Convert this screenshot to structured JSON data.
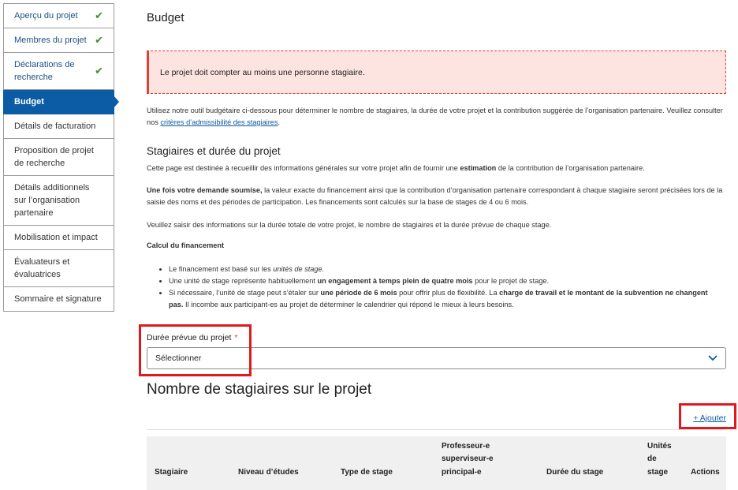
{
  "sidebar": {
    "items": [
      {
        "label": "Aperçu du projet",
        "done": true
      },
      {
        "label": "Membres du projet",
        "done": true
      },
      {
        "label": "Déclarations de recherche",
        "done": true
      },
      {
        "label": "Budget",
        "active": true
      },
      {
        "label": "Détails de facturation"
      },
      {
        "label": "Proposition de projet de recherche"
      },
      {
        "label": "Détails additionnels sur l’organisation partenaire"
      },
      {
        "label": "Mobilisation et impact"
      },
      {
        "label": "Évaluateurs et évaluatrices"
      },
      {
        "label": "Sommaire et signature"
      }
    ]
  },
  "main": {
    "title": "Budget",
    "error": "Le projet doit compter au moins une personne stagiaire.",
    "intro_text": "Utilisez notre outil budgétaire ci-dessous pour déterminer le nombre de stagiaires, la durée de votre projet et la contribution suggérée de l’organisation partenaire. Veuillez consulter nos",
    "intro_link": "critères d’admissibilité des stagiaires",
    "section_title": "Stagiaires et durée du projet",
    "para1_a": "Cette page est destinée à recueillir des informations générales sur votre projet afin de fournir une",
    "para1_b": "estimation",
    "para1_c": "de la contribution de l’organisation partenaire.",
    "para2_a": "Une fois votre demande soumise,",
    "para2_b": "la valeur exacte du financement ainsi que la contribution d’organisation partenaire correspondant à chaque stagiaire seront précisées lors de la saisie des noms et des périodes de participation. Les financements sont calculés sur la base de stages de 4 ou 6 mois.",
    "para3": "Veuillez saisir des informations sur la durée totale de votre projet, le nombre de stagiaires et la durée prévue de chaque stage.",
    "calc_title": "Calcul du financement",
    "b1_a": "Le financement est basé sur les",
    "b1_b": "unités de stage.",
    "b2_a": "Une unité de stage représente habituellement",
    "b2_b": "un engagement à temps plein de quatre mois",
    "b2_c": "pour le projet de stage.",
    "b3_a": "Si nécessaire, l’unité de stage peut s’étaler sur",
    "b3_b": "une période de 6 mois",
    "b3_c": "pour offrir plus de flexibilité. La",
    "b3_d": "charge de travail et le montant de la subvention ne changent pas.",
    "b3_e": "Il incombe aux participant-es au projet de déterminer le calendrier qui répond le mieux à leurs besoins.",
    "field_label": "Durée prévue du projet",
    "required_mark": "*",
    "select_value": "Sélectionner",
    "interns_title": "Nombre de stagiaires sur le projet",
    "add_label": "+ Ajouter",
    "table_headers": [
      "Stagiaire",
      "Niveau d’études",
      "Type de stage",
      "Professeur-e superviseur-e principal-e",
      "Durée du stage",
      "Unités de stage",
      "Actions"
    ]
  },
  "colors": {
    "accent": "#0b5ba5",
    "error": "#d9433a",
    "highlight": "#e0191f",
    "success": "#3a8f2a"
  },
  "icons": {
    "check": "✔",
    "chevron": "⌄"
  }
}
